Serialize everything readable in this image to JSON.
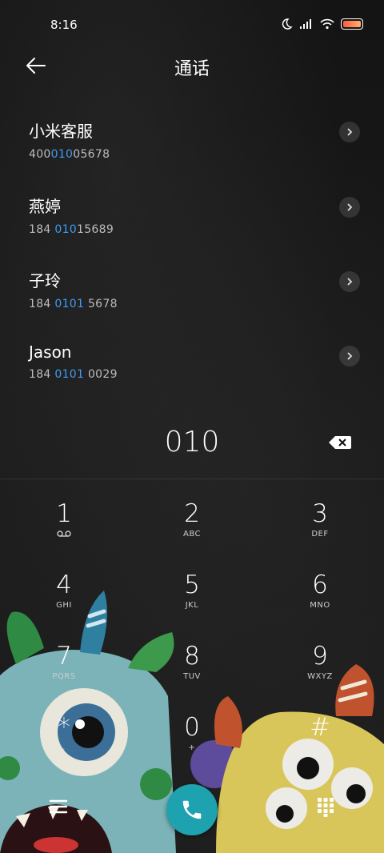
{
  "status": {
    "time": "8:16"
  },
  "header": {
    "title": "通话"
  },
  "contacts": [
    {
      "name": "小米客服",
      "num_pre": "400",
      "num_hl": "010",
      "num_post": "05678"
    },
    {
      "name": "燕婷",
      "num_pre": "184 ",
      "num_hl": "010",
      "num_post": "15689"
    },
    {
      "name": "子玲",
      "num_pre": "184 ",
      "num_hl": "0101",
      "num_post": " 5678"
    },
    {
      "name": "Jason",
      "num_pre": "184 ",
      "num_hl": "0101",
      "num_post": " 0029"
    }
  ],
  "dialer": {
    "entered": "010"
  },
  "keys": [
    {
      "digit": "1",
      "letters": ""
    },
    {
      "digit": "2",
      "letters": "ABC"
    },
    {
      "digit": "3",
      "letters": "DEF"
    },
    {
      "digit": "4",
      "letters": "GHI"
    },
    {
      "digit": "5",
      "letters": "JKL"
    },
    {
      "digit": "6",
      "letters": "MNO"
    },
    {
      "digit": "7",
      "letters": "PQRS"
    },
    {
      "digit": "8",
      "letters": "TUV"
    },
    {
      "digit": "9",
      "letters": "WXYZ"
    },
    {
      "digit": "*",
      "letters": ","
    },
    {
      "digit": "0",
      "letters": "+"
    },
    {
      "digit": "#",
      "letters": ""
    }
  ],
  "colors": {
    "accent": "#3f9bf2",
    "call": "#1fa2b0"
  },
  "icons": {
    "back": "back-arrow-icon",
    "chevron": "chevron-right-icon",
    "backspace": "backspace-icon",
    "voicemail": "voicemail-icon",
    "menu": "menu-icon",
    "call": "phone-icon",
    "keypad": "keypad-icon"
  }
}
